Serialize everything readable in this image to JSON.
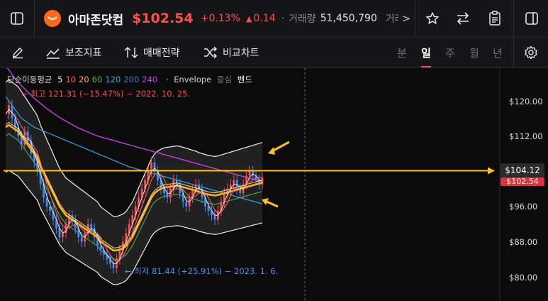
{
  "header": {
    "stock_name": "아마존닷컴",
    "price": "$102.54",
    "change_pct": "+0.13%",
    "change_abs": "0.14",
    "volume_label": "거래량",
    "volume_value": "51,450,790",
    "trade_label_clipped": "거래대",
    "more_glyph": ">"
  },
  "toolbar": {
    "indicator_label": "보조지표",
    "strategy_label": "매매전략",
    "compare_label": "비교차트",
    "periods": [
      "분",
      "일",
      "주",
      "월",
      "년"
    ],
    "active_period": "일"
  },
  "legend": {
    "prefix": "단순이동평균",
    "ma_values": [
      {
        "text": "5",
        "color": "#e6e6e6"
      },
      {
        "text": "10",
        "color": "#ff5a5a"
      },
      {
        "text": "20",
        "color": "#ffb020"
      },
      {
        "text": "60",
        "color": "#4caf50"
      },
      {
        "text": "120",
        "color": "#2aa6e0"
      },
      {
        "text": "200",
        "color": "#3f7bd9"
      },
      {
        "text": "240",
        "color": "#c43fe0"
      }
    ],
    "separator": "·",
    "envelope": "Envelope",
    "center": "중심",
    "band": "밴드"
  },
  "annotations": {
    "high": "← 최고 121.31 (−15.47%) − 2022. 10. 25.",
    "low": "← 최저 81.44 (+25.91%) − 2023. 1. 6."
  },
  "axis": {
    "y_labels": [
      "$120.00",
      "$112.00",
      "$96.00",
      "$88.00",
      "$80.00"
    ],
    "crosshair_price": "$104.12",
    "current_price_tag": "$102.54"
  },
  "colors": {
    "up": "#ff4d4d",
    "down": "#3f8ef5",
    "accent_line": "#ffc21a",
    "ma240": "#c43fe0",
    "ma120": "#2aa6e0",
    "ma60": "#4caf50"
  },
  "chart_data": {
    "type": "candlestick",
    "ylim": [
      78,
      125
    ],
    "y_ticks": [
      80,
      88,
      96,
      104,
      112,
      120
    ],
    "horizontal_line": 104.12,
    "high": {
      "value": 121.31,
      "date": "2022. 10. 25."
    },
    "low": {
      "value": 81.44,
      "date": "2023. 1. 6."
    },
    "closes": [
      117,
      119,
      116,
      114,
      112,
      110,
      113,
      111,
      108,
      106,
      104,
      101,
      98,
      96,
      95,
      93,
      91,
      89,
      90,
      92,
      94,
      93,
      91,
      89,
      88,
      90,
      92,
      91,
      89,
      87,
      86,
      85,
      84,
      83,
      82,
      84,
      86,
      88,
      90,
      92,
      94,
      96,
      98,
      100,
      102,
      104,
      106,
      104,
      102,
      100,
      99,
      98,
      100,
      102,
      101,
      99,
      97,
      96,
      98,
      100,
      101,
      100,
      98,
      96,
      95,
      94,
      93,
      95,
      97,
      99,
      100,
      101,
      102,
      100,
      99,
      101,
      103,
      104,
      103,
      102,
      101,
      102.54
    ],
    "ma20": [
      114,
      114.5,
      114,
      113.5,
      113,
      112,
      111,
      110,
      109,
      108,
      107,
      105,
      103.5,
      102,
      100.5,
      99,
      97.5,
      96,
      95,
      94,
      93.5,
      93,
      92.5,
      92,
      91.5,
      91,
      90.5,
      90,
      89.5,
      89,
      88,
      87.5,
      87,
      86.5,
      86,
      86,
      86.2,
      86.5,
      87,
      88,
      89,
      90.5,
      92,
      93.5,
      95,
      96.5,
      98,
      99,
      99.6,
      100,
      100.3,
      100.4,
      100.5,
      100.6,
      100.7,
      100.6,
      100.4,
      100.2,
      100,
      99.8,
      99.6,
      99.3,
      99.1,
      98.9,
      98.7,
      98.6,
      98.5,
      98.6,
      98.8,
      99,
      99.2,
      99.4,
      99.6,
      99.8,
      100,
      100.2,
      100.4,
      100.6,
      100.8,
      101,
      101.2,
      101.4
    ],
    "ma120": [
      121,
      120,
      119,
      118,
      117,
      116,
      115.5,
      115,
      114.5,
      114,
      113.7,
      113.4,
      113.1,
      112.8,
      112.5,
      112.2,
      111.9,
      111.6,
      111.3,
      111,
      110.7,
      110.4,
      110.1,
      109.8,
      109.5,
      109.2,
      108.9,
      108.6,
      108.3,
      108,
      107.7,
      107.4,
      107.1,
      106.8,
      106.5,
      106.2,
      105.9,
      105.6,
      105.3,
      105,
      104.8,
      104.6,
      104.4,
      104.2,
      104,
      103.8,
      103.6,
      103.4,
      103.2,
      103,
      102.8,
      102.6,
      102.4,
      102.2,
      102,
      101.8,
      101.6,
      101.4,
      101.2,
      101,
      100.8,
      100.6,
      100.4,
      100.2,
      100,
      99.8,
      99.6,
      99.4,
      99.2,
      99,
      98.8,
      98.6,
      98.4,
      98.2,
      98,
      97.8,
      97.6,
      97.4,
      97.2,
      97,
      96.8,
      96.6
    ],
    "ma240": [
      128,
      127,
      126,
      125,
      124.2,
      123.4,
      122.7,
      122,
      121.3,
      120.6,
      120,
      119.4,
      118.8,
      118.2,
      117.7,
      117.2,
      116.7,
      116.2,
      115.8,
      115.4,
      115,
      114.6,
      114.2,
      113.8,
      113.5,
      113.2,
      112.9,
      112.6,
      112.3,
      112,
      111.8,
      111.6,
      111.4,
      111.2,
      111,
      110.8,
      110.6,
      110.4,
      110.2,
      110,
      109.8,
      109.6,
      109.4,
      109.2,
      109,
      108.8,
      108.6,
      108.4,
      108.2,
      108,
      107.8,
      107.6,
      107.4,
      107.2,
      107,
      106.8,
      106.6,
      106.4,
      106.2,
      106,
      105.8,
      105.6,
      105.4,
      105.2,
      105,
      104.8,
      104.6,
      104.4,
      104.2,
      104,
      103.8,
      103.6,
      103.4,
      103.2,
      103,
      102.8,
      102.6,
      102.4,
      102.2,
      102,
      101.8,
      101.6
    ]
  }
}
